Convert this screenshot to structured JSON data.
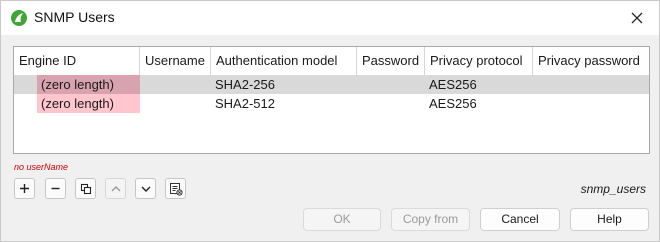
{
  "window": {
    "title": "SNMP Users"
  },
  "table": {
    "columns": [
      "Engine ID",
      "Username",
      "Authentication model",
      "Password",
      "Privacy protocol",
      "Privacy password"
    ],
    "rows": [
      {
        "engine_id": "(zero length)",
        "username": "",
        "auth_model": "SHA2-256",
        "password": "",
        "privacy_protocol": "AES256",
        "privacy_password": ""
      },
      {
        "engine_id": "(zero length)",
        "username": "",
        "auth_model": "SHA2-512",
        "password": "",
        "privacy_protocol": "AES256",
        "privacy_password": ""
      }
    ]
  },
  "status": {
    "message": "no userName"
  },
  "toolbar": {
    "icons": [
      "add-icon",
      "remove-icon",
      "copy-icon",
      "move-up-icon",
      "move-down-icon",
      "clear-icon"
    ]
  },
  "file_label": "snmp_users",
  "buttons": {
    "ok": "OK",
    "copy_from": "Copy from",
    "cancel": "Cancel",
    "help": "Help"
  },
  "colors": {
    "selected_row": "#d9d9d9",
    "error_cell_selected": "#d8a3ae",
    "error_cell": "#ffc6cf",
    "status_text": "#d40000",
    "app_icon": "#3fa535"
  }
}
